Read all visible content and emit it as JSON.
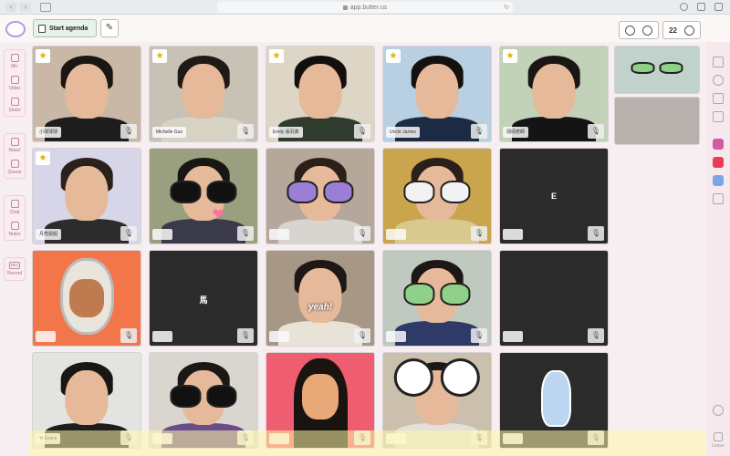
{
  "browser": {
    "url": "app.butter.us"
  },
  "topbar": {
    "agenda_label": "Start agenda",
    "participant_count": "22"
  },
  "leftbar": {
    "items": [
      {
        "label": "Mic",
        "icon": "mic-icon"
      },
      {
        "label": "Video",
        "icon": "video-icon"
      },
      {
        "label": "Share",
        "icon": "share-icon"
      },
      {
        "label": "React",
        "icon": "react-icon"
      },
      {
        "label": "Queue",
        "icon": "queue-icon"
      },
      {
        "label": "Chat",
        "icon": "chat-icon"
      },
      {
        "label": "Notes",
        "icon": "notes-icon"
      },
      {
        "label": "Record",
        "icon": "record-icon",
        "badge": "REC"
      }
    ]
  },
  "rightbar": {
    "leave_label": "Leave"
  },
  "participants": [
    {
      "name": "小球球球",
      "starred": true,
      "kind": "video",
      "bg": "#c9b8a6",
      "shirt": "#1d1d1d",
      "hair": "#1a1614"
    },
    {
      "name": "Michelle Guo",
      "starred": true,
      "kind": "video",
      "bg": "#c7c2b5",
      "shirt": "#d6d2c4",
      "hair": "#201a17"
    },
    {
      "name": "Emily 張羽柔",
      "starred": true,
      "kind": "video",
      "bg": "#ddd6c6",
      "shirt": "#2e3b2d",
      "hair": "#120f0e"
    },
    {
      "name": "Uncle James",
      "starred": true,
      "kind": "video",
      "bg": "#b8d0e2",
      "shirt": "#1c2b44",
      "hair": "#14110f"
    },
    {
      "name": "翊翊老師",
      "starred": true,
      "kind": "video",
      "bg": "#c2d2b8",
      "shirt": "#141414",
      "hair": "#1a1614"
    },
    {
      "name": "月亮姐姐",
      "starred": true,
      "kind": "video",
      "bg": "#d7d5e8",
      "shirt": "#2c2c2c",
      "hair": "#2a211b"
    },
    {
      "name": "",
      "starred": false,
      "kind": "video",
      "bg": "#9aa07f",
      "shirt": "#3a3a4a",
      "hair": "#1a1614",
      "sticker": "sunglasses-heart"
    },
    {
      "name": "",
      "starred": false,
      "kind": "video",
      "bg": "#b5a89a",
      "shirt": "#d8d4cf",
      "hair": "#2a2019",
      "sticker": "purple-glasses"
    },
    {
      "name": "",
      "starred": false,
      "kind": "video",
      "bg": "#caa54e",
      "shirt": "#d8c98e",
      "hair": "#2a2019",
      "sticker": "eye-glasses"
    },
    {
      "name": "",
      "starred": false,
      "kind": "letter",
      "letter": "E"
    },
    {
      "name": "",
      "starred": false,
      "kind": "astronaut",
      "bg": "#f2764a"
    },
    {
      "name": "",
      "starred": false,
      "kind": "letter",
      "letter": "馬"
    },
    {
      "name": "",
      "starred": false,
      "kind": "video",
      "bg": "#a79785",
      "shirt": "#e9e2d6",
      "hair": "#1d1815",
      "sticker": "yeah"
    },
    {
      "name": "",
      "starred": false,
      "kind": "video",
      "bg": "#c0c9c0",
      "shirt": "#2f3a66",
      "hair": "#1d1815",
      "sticker": "frog-glasses"
    },
    {
      "name": "",
      "starred": false,
      "kind": "letter",
      "letter": ""
    },
    {
      "name": "Yi Grace",
      "starred": false,
      "kind": "video",
      "bg": "#e3e3e0",
      "shirt": "#1d1d1d",
      "hair": "#1a1614"
    },
    {
      "name": "",
      "starred": false,
      "kind": "video",
      "bg": "#d9d5cf",
      "shirt": "#6a4c8a",
      "hair": "#1d1815",
      "sticker": "eye-glasses-small"
    },
    {
      "name": "",
      "starred": false,
      "kind": "cartoon-girl",
      "bg": "#ee5d70"
    },
    {
      "name": "",
      "starred": false,
      "kind": "video",
      "bg": "#cbbfae",
      "shirt": "#e2e0d9",
      "hair": "#1d1815",
      "sticker": "big-eyes"
    },
    {
      "name": "",
      "starred": false,
      "kind": "gummy",
      "bg": "#2b2b2b"
    }
  ],
  "side_participants": [
    {
      "name": "",
      "bg": "#c0d2c9",
      "sticker": "frog-glasses"
    },
    {
      "name": "",
      "bg": "#b8b0ad"
    }
  ],
  "colors": {
    "accent_green": "#e7f2ea",
    "sidebar_pink": "#fbecf1",
    "star_yellow": "#e0b400"
  }
}
